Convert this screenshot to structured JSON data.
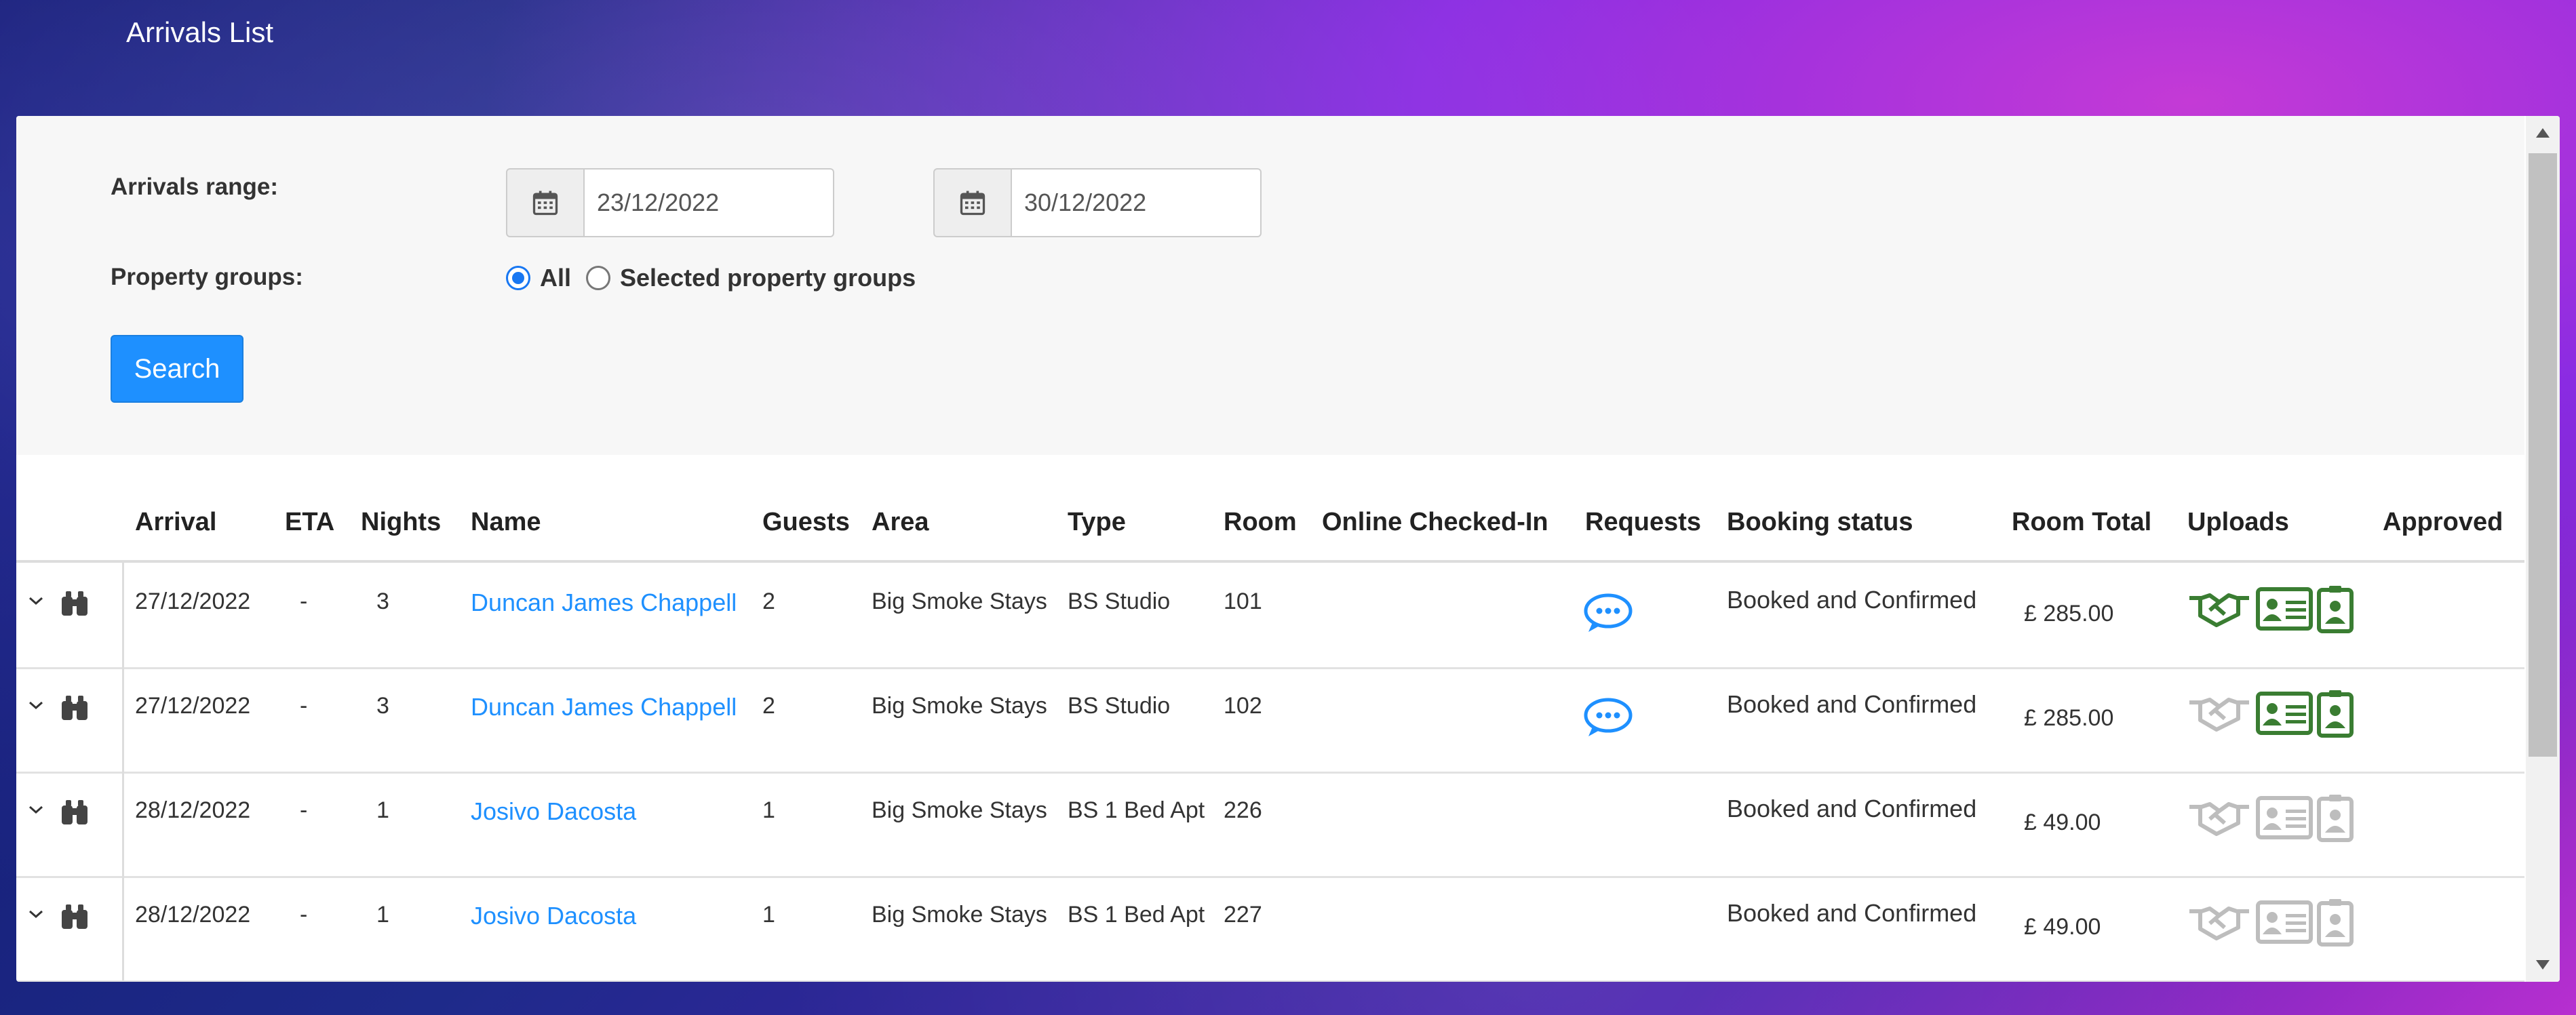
{
  "header": {
    "title": "Arrivals List"
  },
  "filters": {
    "arrivals_range_label": "Arrivals range:",
    "start_date": "23/12/2022",
    "end_date": "30/12/2022",
    "property_groups_label": "Property groups:",
    "option_all": "All",
    "option_selected": "Selected property groups",
    "selected_option": "All",
    "search_label": "Search"
  },
  "table": {
    "columns": [
      "Arrival",
      "ETA",
      "Nights",
      "Name",
      "Guests",
      "Area",
      "Type",
      "Room",
      "Online Checked-In",
      "Requests",
      "Booking status",
      "Room Total",
      "Uploads",
      "Approved"
    ],
    "rows": [
      {
        "arrival": "27/12/2022",
        "eta": "-",
        "nights": "3",
        "name": "Duncan James Chappell",
        "guests": "2",
        "area": "Big Smoke Stays",
        "type": "BS Studio",
        "room": "101",
        "online_checked_in": "",
        "has_request": true,
        "status": "Booked and Confirmed",
        "total": "£ 285.00",
        "uploads": {
          "agreement": true,
          "id": true,
          "badge": true
        },
        "approved": ""
      },
      {
        "arrival": "27/12/2022",
        "eta": "-",
        "nights": "3",
        "name": "Duncan James Chappell",
        "guests": "2",
        "area": "Big Smoke Stays",
        "type": "BS Studio",
        "room": "102",
        "online_checked_in": "",
        "has_request": true,
        "status": "Booked and Confirmed",
        "total": "£ 285.00",
        "uploads": {
          "agreement": false,
          "id": true,
          "badge": true
        },
        "approved": ""
      },
      {
        "arrival": "28/12/2022",
        "eta": "-",
        "nights": "1",
        "name": "Josivo Dacosta",
        "guests": "1",
        "area": "Big Smoke Stays",
        "type": "BS 1 Bed Apt",
        "room": "226",
        "online_checked_in": "",
        "has_request": false,
        "status": "Booked and Confirmed",
        "total": "£ 49.00",
        "uploads": {
          "agreement": false,
          "id": false,
          "badge": false
        },
        "approved": ""
      },
      {
        "arrival": "28/12/2022",
        "eta": "-",
        "nights": "1",
        "name": "Josivo Dacosta",
        "guests": "1",
        "area": "Big Smoke Stays",
        "type": "BS 1 Bed Apt",
        "room": "227",
        "online_checked_in": "",
        "has_request": false,
        "status": "Booked and Confirmed",
        "total": "£ 49.00",
        "uploads": {
          "agreement": false,
          "id": false,
          "badge": false
        },
        "approved": ""
      }
    ]
  },
  "colors": {
    "accent": "#1e90ff",
    "upload_done": "#3a7d32",
    "upload_pending": "#bdbdbd"
  },
  "icons": [
    "calendar-icon",
    "chevron-down-icon",
    "binoculars-icon",
    "chat-bubble-icon",
    "handshake-icon",
    "id-card-icon",
    "badge-icon"
  ]
}
